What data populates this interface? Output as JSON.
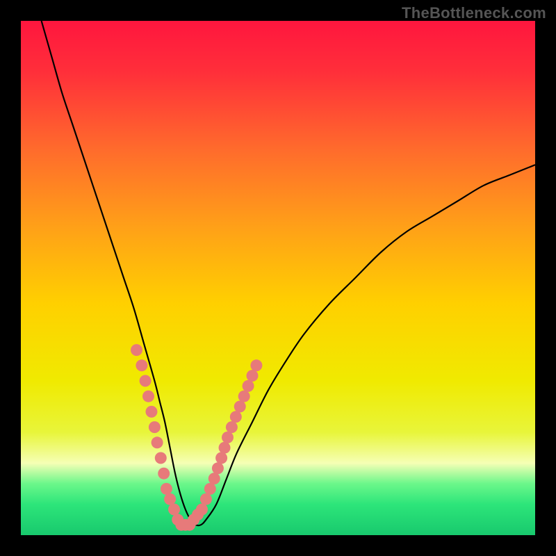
{
  "watermark": "TheBottleneck.com",
  "colors": {
    "gradient_stops": [
      {
        "offset": 0.0,
        "color": "#ff163e"
      },
      {
        "offset": 0.1,
        "color": "#ff2f3a"
      },
      {
        "offset": 0.25,
        "color": "#ff6b2c"
      },
      {
        "offset": 0.4,
        "color": "#ffa018"
      },
      {
        "offset": 0.55,
        "color": "#ffd000"
      },
      {
        "offset": 0.7,
        "color": "#f0ea00"
      },
      {
        "offset": 0.8,
        "color": "#e8f53a"
      },
      {
        "offset": 0.86,
        "color": "#f5ffb5"
      },
      {
        "offset": 0.9,
        "color": "#6bf78a"
      },
      {
        "offset": 0.94,
        "color": "#2de57a"
      },
      {
        "offset": 1.0,
        "color": "#18c96d"
      }
    ],
    "curve_stroke": "#000000",
    "marker_fill": "#e77a7a",
    "marker_stroke": "#d86666"
  },
  "chart_data": {
    "type": "line",
    "title": "",
    "xlabel": "",
    "ylabel": "",
    "xlim": [
      0,
      100
    ],
    "ylim": [
      0,
      100
    ],
    "series": [
      {
        "name": "bottleneck-curve",
        "x": [
          4,
          6,
          8,
          10,
          12,
          14,
          16,
          18,
          20,
          22,
          24,
          26,
          27,
          28,
          29,
          30,
          31,
          32,
          33,
          34,
          35,
          36,
          38,
          40,
          42,
          45,
          48,
          51,
          55,
          60,
          65,
          70,
          75,
          80,
          85,
          90,
          95,
          100
        ],
        "y": [
          100,
          93,
          86,
          80,
          74,
          68,
          62,
          56,
          50,
          44,
          37,
          30,
          26,
          22,
          17,
          12,
          8,
          5,
          3,
          2,
          2,
          3,
          6,
          11,
          16,
          22,
          28,
          33,
          39,
          45,
          50,
          55,
          59,
          62,
          65,
          68,
          70,
          72
        ]
      }
    ],
    "markers": {
      "name": "highlighted-points",
      "x": [
        22.5,
        23.5,
        24.2,
        24.8,
        25.4,
        26.0,
        26.5,
        27.2,
        27.8,
        28.3,
        29.0,
        29.8,
        30.5,
        31.2,
        32.0,
        32.8,
        33.6,
        34.4,
        35.2,
        36.0,
        36.8,
        37.6,
        38.3,
        39.0,
        39.6,
        40.2,
        41.0,
        41.8,
        42.6,
        43.4,
        44.2,
        45.0,
        45.8
      ],
      "y": [
        36,
        33,
        30,
        27,
        24,
        21,
        18,
        15,
        12,
        9,
        7,
        5,
        3,
        2,
        2,
        2,
        3,
        4,
        5,
        7,
        9,
        11,
        13,
        15,
        17,
        19,
        21,
        23,
        25,
        27,
        29,
        31,
        33
      ]
    }
  }
}
